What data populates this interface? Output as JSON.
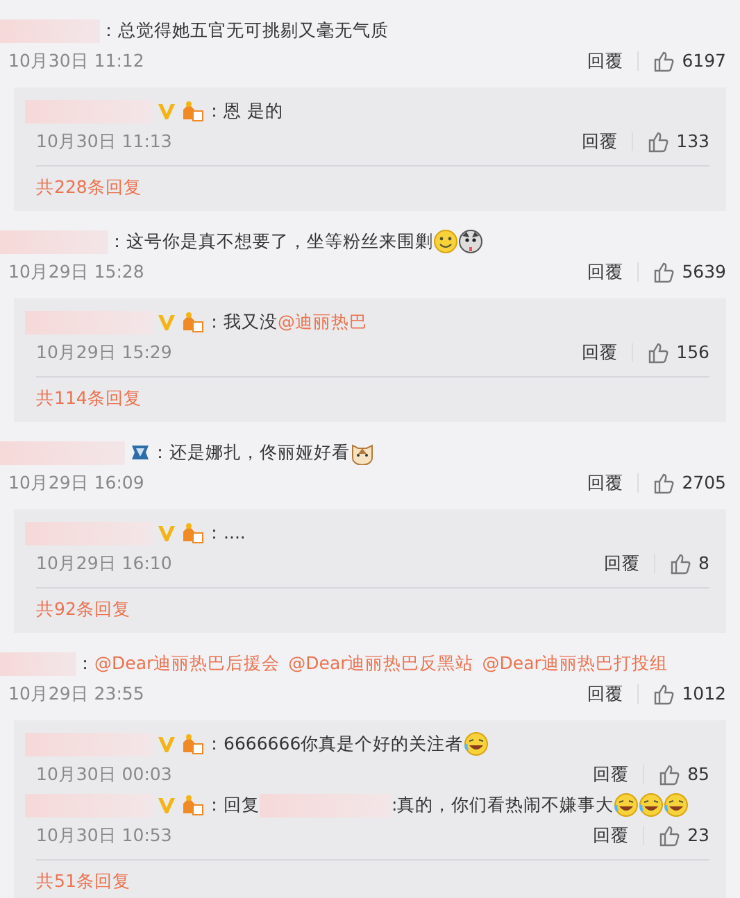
{
  "comments": [
    {
      "content": [
        {
          "kind": "text",
          "text": "：总觉得她五官无可挑剔又毫无气质"
        }
      ],
      "time": "10月30日 11:12",
      "reply_label": "回覆",
      "likes": "6197",
      "replies": [
        {
          "badges": [
            {
              "kind": "verified"
            },
            {
              "kind": "level"
            }
          ],
          "content": [
            {
              "kind": "text",
              "text": "：恩 是的"
            }
          ],
          "time": "10月30日 11:13",
          "reply_label": "回覆",
          "likes": "133"
        }
      ],
      "total": "共228条回复"
    },
    {
      "content": [
        {
          "kind": "text",
          "text": "：这号你是真不想要了，坐等粉丝来围剿"
        },
        {
          "kind": "smile"
        },
        {
          "kind": "dog"
        }
      ],
      "time": "10月29日 15:28",
      "reply_label": "回覆",
      "likes": "5639",
      "replies": [
        {
          "badges": [
            {
              "kind": "verified"
            },
            {
              "kind": "level"
            }
          ],
          "content": [
            {
              "kind": "text",
              "text": "：我又没"
            },
            {
              "kind": "mention",
              "text": "@迪丽热巴"
            }
          ],
          "time": "10月29日 15:29",
          "reply_label": "回覆",
          "likes": "156"
        }
      ],
      "total": "共114条回复"
    },
    {
      "badges": [
        {
          "kind": "diamond"
        }
      ],
      "content": [
        {
          "kind": "text",
          "text": "：还是娜扎，佟丽娅好看"
        },
        {
          "kind": "cat"
        }
      ],
      "time": "10月29日 16:09",
      "reply_label": "回覆",
      "likes": "2705",
      "replies": [
        {
          "badges": [
            {
              "kind": "verified"
            },
            {
              "kind": "level"
            }
          ],
          "content": [
            {
              "kind": "text",
              "text": "：...."
            }
          ],
          "time": "10月29日 16:10",
          "reply_label": "回覆",
          "likes": "8"
        }
      ],
      "total": "共92条回复"
    },
    {
      "content": [
        {
          "kind": "text",
          "text": "："
        },
        {
          "kind": "mention",
          "text": "@Dear迪丽热巴后援会"
        },
        {
          "kind": "mention",
          "text": "@Dear迪丽热巴反黑站"
        },
        {
          "kind": "mention",
          "text": "@Dear迪丽热巴打投组"
        }
      ],
      "time": "10月29日 23:55",
      "reply_label": "回覆",
      "likes": "1012",
      "replies": [
        {
          "badges": [
            {
              "kind": "verified"
            },
            {
              "kind": "level"
            }
          ],
          "content": [
            {
              "kind": "text",
              "text": "：6666666你真是个好的关注者"
            },
            {
              "kind": "laugh"
            }
          ],
          "time": "10月30日 00:03",
          "reply_label": "回覆",
          "likes": "85"
        },
        {
          "badges": [
            {
              "kind": "verified"
            },
            {
              "kind": "level"
            }
          ],
          "content": [
            {
              "kind": "text",
              "text": "：回复"
            },
            {
              "kind": "blur"
            },
            {
              "kind": "text",
              "text": ":真的，你们看热闹不嫌事大"
            },
            {
              "kind": "laugh"
            },
            {
              "kind": "laugh"
            },
            {
              "kind": "laugh"
            }
          ],
          "time": "10月30日 10:53",
          "reply_label": "回覆",
          "likes": "23"
        }
      ],
      "total": "共51条回复"
    }
  ]
}
